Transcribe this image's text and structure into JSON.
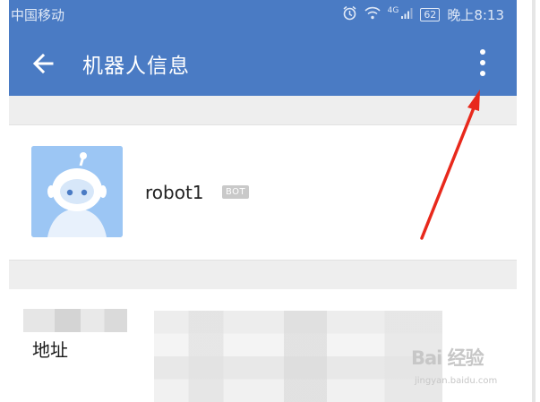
{
  "status_bar": {
    "carrier": "中国移动",
    "network": "4G",
    "battery": "62",
    "time": "晚上8:13"
  },
  "app_bar": {
    "title": "机器人信息",
    "back_icon": "arrow-left-icon",
    "more_icon": "more-vertical-icon"
  },
  "bot": {
    "name": "robot1",
    "badge": "BOT",
    "avatar_icon": "robot-avatar-icon"
  },
  "address": {
    "label": "地址"
  },
  "watermark": {
    "logo": "Bai 经验",
    "sub": "jingyan.baidu.com"
  },
  "colors": {
    "primary": "#4a7bc4",
    "annotation_arrow": "#e8291c",
    "avatar_bg": "#9cc6f4",
    "section_gap": "#eeeeee"
  }
}
